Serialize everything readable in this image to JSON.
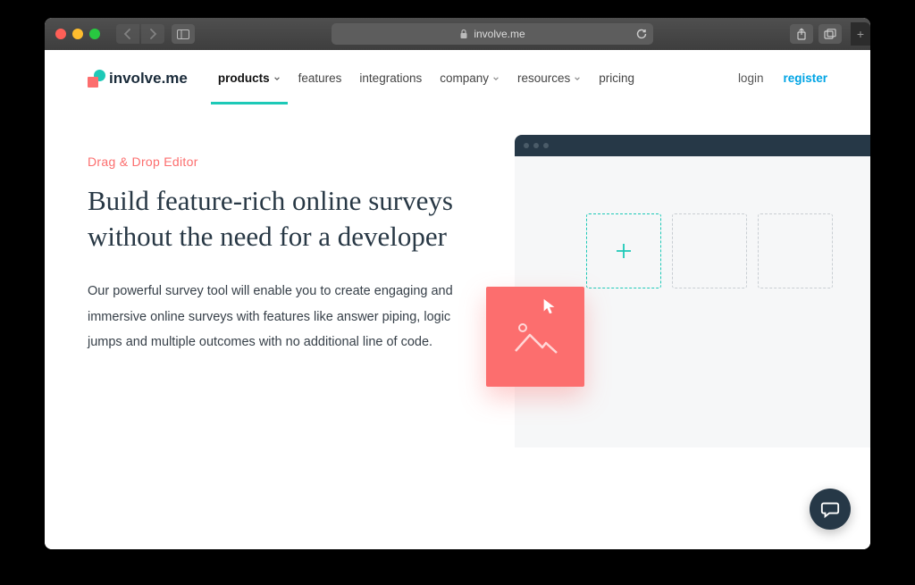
{
  "browser": {
    "url_host": "involve.me"
  },
  "site": {
    "logo_text": "involve.me",
    "nav": {
      "products": "products",
      "features": "features",
      "integrations": "integrations",
      "company": "company",
      "resources": "resources",
      "pricing": "pricing"
    },
    "auth": {
      "login": "login",
      "register": "register"
    }
  },
  "hero": {
    "eyebrow": "Drag & Drop Editor",
    "title": "Build feature-rich online surveys without the need for a developer",
    "body": "Our powerful survey tool will enable you to create engaging and immersive online surveys with features like answer piping, logic jumps and multiple outcomes with no additional line of code."
  }
}
